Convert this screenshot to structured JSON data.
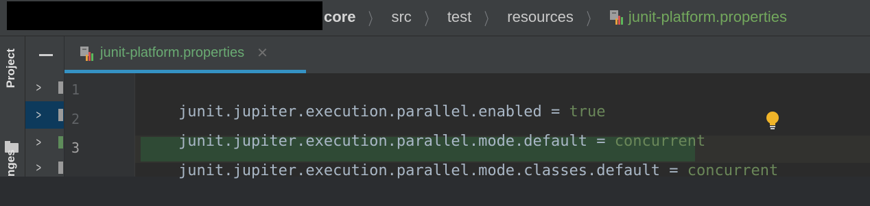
{
  "breadcrumb": {
    "items": [
      "core",
      "src",
      "test",
      "resources"
    ],
    "file": "junit-platform.properties"
  },
  "toolwindow": {
    "project_label": "Project",
    "partial_label": "nges"
  },
  "tab": {
    "label": "junit-platform.properties",
    "close_glyph": "✕"
  },
  "editor": {
    "lines": [
      {
        "number": "1",
        "key": "junit.jupiter.execution.parallel.enabled",
        "eq": " = ",
        "value": "true"
      },
      {
        "number": "2",
        "key": "junit.jupiter.execution.parallel.mode.default",
        "eq": " = ",
        "value": "concurrent"
      },
      {
        "number": "3",
        "key": "junit.jupiter.execution.parallel.mode.classes.default",
        "eq": " = ",
        "value": "concurrent"
      }
    ],
    "current_line": 3
  },
  "colors": {
    "accent_tab_underline": "#3592c4",
    "file_name_green": "#6aab73",
    "value_green": "#6a8759",
    "intention_bulb": "#f0b429"
  },
  "icons": [
    "properties-file-icon",
    "chevron-right-icon",
    "folder-icon",
    "close-icon",
    "lightbulb-icon",
    "collapse-icon"
  ]
}
